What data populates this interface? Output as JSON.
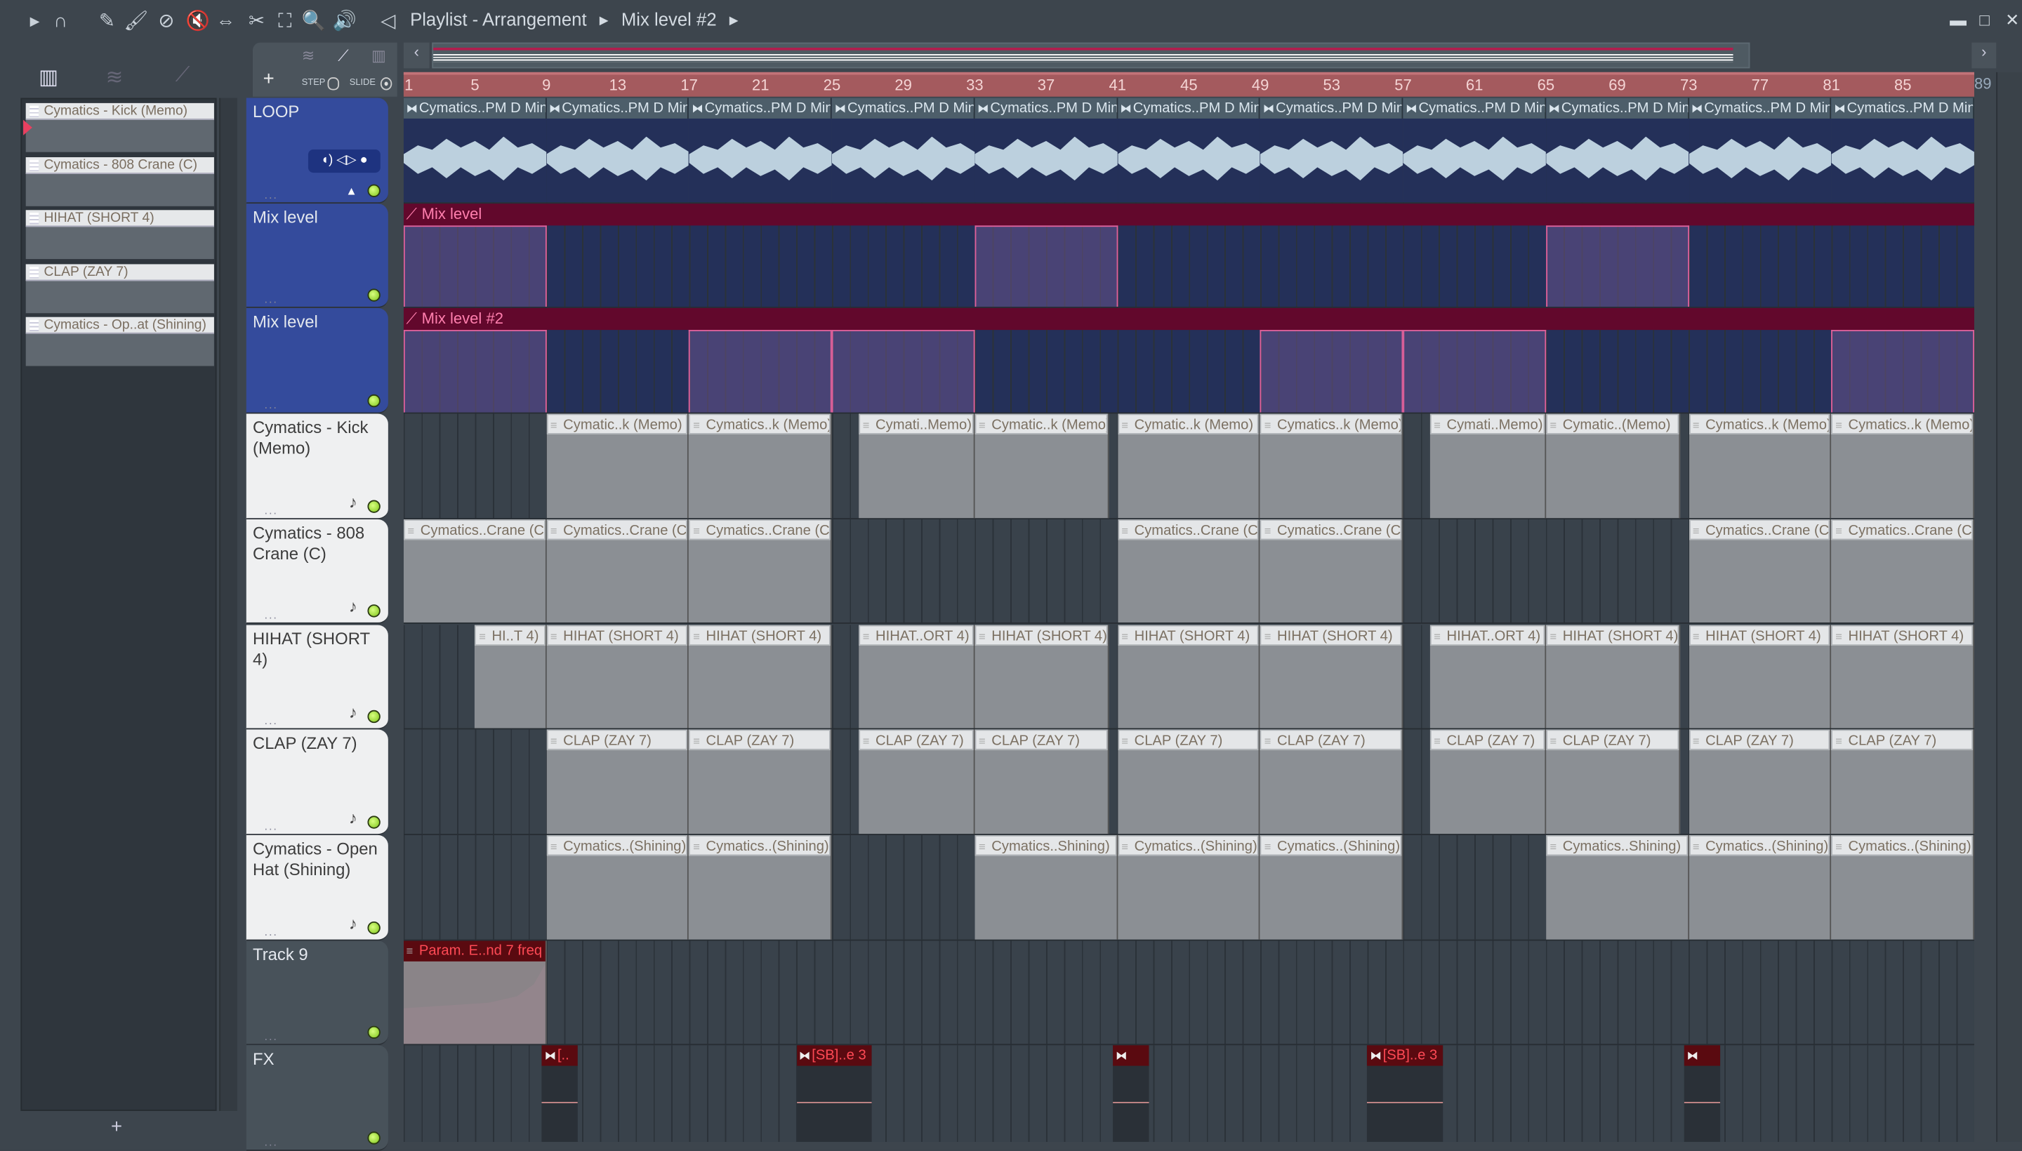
{
  "toolbar": {
    "icons": [
      "play-arrow-icon",
      "magnet-icon",
      "pencil-icon",
      "paint-brush-icon",
      "delete-icon",
      "mute-icon",
      "slip-icon",
      "slice-icon",
      "select-icon",
      "zoom-icon",
      "playback-icon"
    ],
    "title": "Playlist - Arrangement",
    "current_pattern": "Mix level #2"
  },
  "window_controls": {
    "minimize": "▬",
    "maximize": "□",
    "close": "✕"
  },
  "tool_panel": {
    "add_label": "+",
    "step_label": "STEP",
    "slide_label": "SLIDE"
  },
  "browser": {
    "add_label": "+",
    "items": [
      "Cymatics - Kick (Memo)",
      "Cymatics - 808 Crane (C)",
      "HIHAT (SHORT 4)",
      "CLAP (ZAY 7)",
      "Cymatics - Op..at (Shining)"
    ]
  },
  "ruler": {
    "ticks": [
      "1",
      "5",
      "9",
      "13",
      "17",
      "21",
      "25",
      "29",
      "33",
      "37",
      "41",
      "45",
      "49",
      "53",
      "57",
      "61",
      "65",
      "69",
      "73",
      "77",
      "81",
      "85",
      "89"
    ]
  },
  "colors": {
    "accent": "#a45a5e",
    "audio": "#243059",
    "automation": "#62082c",
    "led": "#7ec41a"
  },
  "tracks": [
    {
      "name": "LOOP",
      "type": "audio",
      "clips": [
        [
          1,
          8,
          "Cymatics..PM D Min"
        ],
        [
          9,
          8,
          "Cymatics..PM D Min"
        ],
        [
          17,
          8,
          "Cymatics..PM D Min"
        ],
        [
          25,
          8,
          "Cymatics..PM D Min"
        ],
        [
          33,
          8,
          "Cymatics..PM D Min"
        ],
        [
          41,
          8,
          "Cymatics..PM D Min"
        ],
        [
          49,
          8,
          "Cymatics..PM D Min"
        ],
        [
          57,
          8,
          "Cymatics..PM D Min"
        ],
        [
          65,
          8,
          "Cymatics..PM D Min"
        ],
        [
          73,
          8,
          "Cymatics..PM D Min"
        ],
        [
          81,
          8,
          "Cymatics..PM D Min"
        ]
      ]
    },
    {
      "name": "Mix level",
      "type": "automation",
      "clip_label": "Mix level",
      "high": [
        [
          1,
          8
        ],
        [
          33,
          8
        ],
        [
          65,
          8
        ]
      ]
    },
    {
      "name": "Mix level",
      "type": "automation",
      "clip_label": "Mix level #2",
      "high": [
        [
          1,
          8
        ],
        [
          17,
          8
        ],
        [
          25,
          8
        ],
        [
          49,
          8
        ],
        [
          57,
          8
        ],
        [
          81,
          8
        ]
      ]
    },
    {
      "name": "Cymatics - Kick (Memo)",
      "type": "pattern",
      "clips": [
        [
          9,
          8,
          "Cymatic..k (Memo)"
        ],
        [
          17,
          8,
          "Cymatics..k (Memo)"
        ],
        [
          26.5,
          6.5,
          "Cymati..Memo)"
        ],
        [
          33,
          7.5,
          "Cymatic..k (Memo)"
        ],
        [
          41,
          8,
          "Cymatic..k (Memo)"
        ],
        [
          49,
          8,
          "Cymatics..k (Memo)"
        ],
        [
          58.5,
          6.5,
          "Cymati..Memo)"
        ],
        [
          65,
          7.5,
          "Cymatic..(Memo)"
        ],
        [
          73,
          8,
          "Cymatics..k (Memo)"
        ],
        [
          81,
          8,
          "Cymatics..k (Memo)"
        ]
      ]
    },
    {
      "name": "Cymatics - 808 Crane (C)",
      "type": "pattern",
      "clips": [
        [
          1,
          8,
          "Cymatics..Crane (C)"
        ],
        [
          9,
          8,
          "Cymatics..Crane (C)"
        ],
        [
          17,
          8,
          "Cymatics..Crane (C)"
        ],
        [
          41,
          8,
          "Cymatics..Crane (C)"
        ],
        [
          49,
          8,
          "Cymatics..Crane (C)"
        ],
        [
          73,
          8,
          "Cymatics..Crane (C)"
        ],
        [
          81,
          8,
          "Cymatics..Crane (C)"
        ]
      ]
    },
    {
      "name": "HIHAT (SHORT 4)",
      "type": "pattern",
      "clips": [
        [
          5,
          4,
          "HI..T 4)"
        ],
        [
          9,
          8,
          "HIHAT (SHORT 4)"
        ],
        [
          17,
          8,
          "HIHAT (SHORT 4)"
        ],
        [
          26.5,
          6.5,
          "HIHAT..ORT 4)"
        ],
        [
          33,
          7.5,
          "HIHAT (SHORT 4)"
        ],
        [
          41,
          8,
          "HIHAT (SHORT 4)"
        ],
        [
          49,
          8,
          "HIHAT (SHORT 4)"
        ],
        [
          58.5,
          6.5,
          "HIHAT..ORT 4)"
        ],
        [
          65,
          7.5,
          "HIHAT (SHORT 4)"
        ],
        [
          73,
          8,
          "HIHAT (SHORT 4)"
        ],
        [
          81,
          8,
          "HIHAT (SHORT 4)"
        ]
      ]
    },
    {
      "name": "CLAP (ZAY 7)",
      "type": "pattern",
      "clips": [
        [
          9,
          8,
          "CLAP (ZAY 7)"
        ],
        [
          17,
          8,
          "CLAP (ZAY 7)"
        ],
        [
          26.5,
          6.5,
          "CLAP (ZAY 7)"
        ],
        [
          33,
          7.5,
          "CLAP (ZAY 7)"
        ],
        [
          41,
          8,
          "CLAP (ZAY 7)"
        ],
        [
          49,
          8,
          "CLAP (ZAY 7)"
        ],
        [
          58.5,
          6.5,
          "CLAP (ZAY 7)"
        ],
        [
          65,
          7.5,
          "CLAP (ZAY 7)"
        ],
        [
          73,
          8,
          "CLAP (ZAY 7)"
        ],
        [
          81,
          8,
          "CLAP (ZAY 7)"
        ]
      ]
    },
    {
      "name": "Cymatics - Open Hat (Shining)",
      "type": "pattern",
      "clips": [
        [
          9,
          8,
          "Cymatics..(Shining)"
        ],
        [
          17,
          8,
          "Cymatics..(Shining)"
        ],
        [
          33,
          8,
          "Cymatics..Shining)"
        ],
        [
          41,
          8,
          "Cymatics..(Shining)"
        ],
        [
          49,
          8,
          "Cymatics..(Shining)"
        ],
        [
          65,
          8,
          "Cymatics..Shining)"
        ],
        [
          73,
          8,
          "Cymatics..(Shining)"
        ],
        [
          81,
          8,
          "Cymatics..(Shining)"
        ]
      ]
    },
    {
      "name": "Track 9",
      "type": "param",
      "clips": [
        [
          1,
          8,
          "Param. E..nd 7 freq"
        ]
      ]
    },
    {
      "name": "FX",
      "type": "fx",
      "clips": [
        [
          8.75,
          2,
          "[.."
        ],
        [
          23,
          4.25,
          "[SB]..e 3"
        ],
        [
          40.75,
          2,
          ""
        ],
        [
          55,
          4.25,
          "[SB]..e 3"
        ],
        [
          72.75,
          2,
          ""
        ]
      ]
    }
  ]
}
